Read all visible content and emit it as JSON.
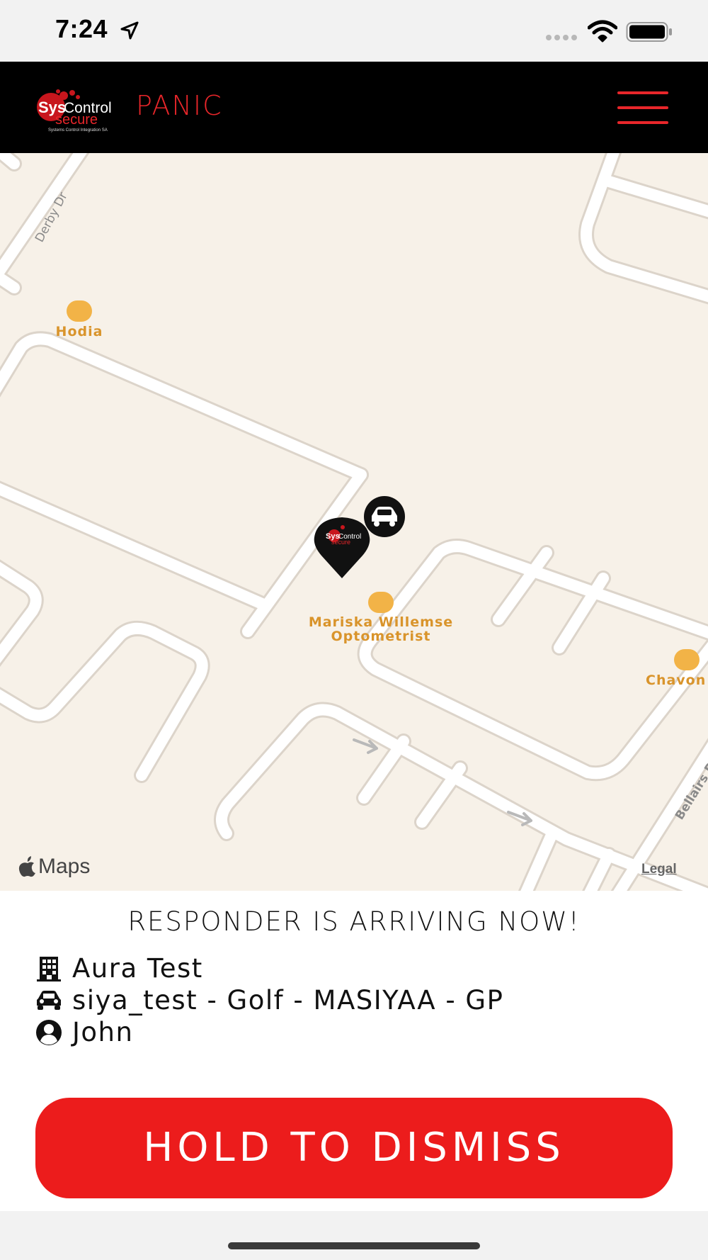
{
  "status_bar": {
    "time": "7:24",
    "icons": [
      "location-arrow-icon",
      "signal-dots-icon",
      "wifi-icon",
      "battery-icon"
    ]
  },
  "header": {
    "logo_text": "SysControl secure",
    "logo_tagline": "Systems Control Integration SA",
    "title": "PANIC",
    "menu_icon": "hamburger-menu-icon",
    "accent_color": "#e8262a"
  },
  "map": {
    "streets": [
      "Derby Dr",
      "Bellairs D"
    ],
    "pois": [
      {
        "name": "Hodia",
        "icon": "briefcase-icon"
      },
      {
        "name": "Mariska Willemse Optometrist",
        "icon": "glasses-icon"
      },
      {
        "name": "Chavon",
        "icon": "briefcase-icon"
      }
    ],
    "attribution": "Maps",
    "legal": "Legal",
    "markers": [
      "location-pin-icon",
      "car-marker-icon"
    ]
  },
  "info": {
    "heading": "RESPONDER IS ARRIVING NOW!",
    "site": "Aura Test",
    "vehicle": "siya_test - Golf - MASIYAA - GP",
    "responder": "John"
  },
  "dismiss": {
    "label": "HOLD TO DISMISS",
    "color": "#ec1c1c"
  }
}
